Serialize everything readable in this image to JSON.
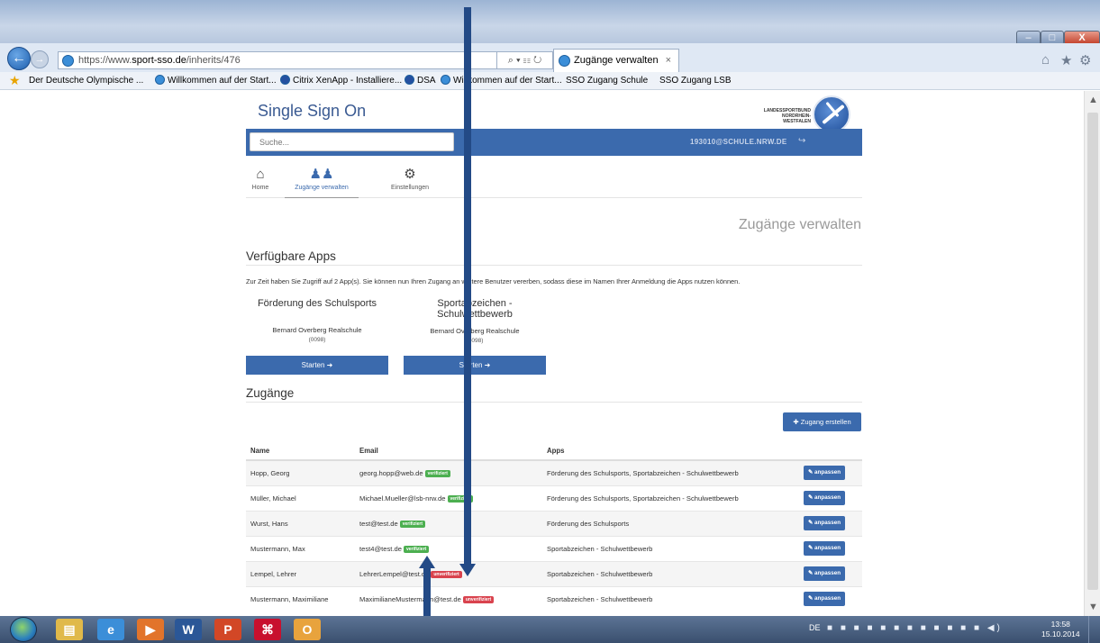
{
  "browser": {
    "url_prefix": "https://www.",
    "url_domain": "sport-sso.de",
    "url_path": "/inherits/476",
    "url_controls": "⌕ ▾ ☷ ↻",
    "tab_title": "Zugänge verwalten",
    "tab_close": "×",
    "window_buttons": {
      "minimize": "–",
      "maximize": "□",
      "close": "X"
    },
    "right_icons": [
      "⌂",
      "★",
      "⚙"
    ]
  },
  "favorites": [
    {
      "label": "Der Deutsche Olympische ...",
      "icon": "dosb-icon"
    },
    {
      "label": "Willkommen auf der Start...",
      "icon": "ie-icon"
    },
    {
      "label": "Citrix XenApp - Installiere...",
      "icon": "citrix-icon"
    },
    {
      "label": "DSA",
      "icon": "citrix-icon"
    },
    {
      "label": "Willkommen auf der Start...",
      "icon": "ie-icon"
    },
    {
      "label": "SSO Zugang Schule",
      "icon": "page-icon"
    },
    {
      "label": "SSO Zugang LSB",
      "icon": "page-icon"
    }
  ],
  "site": {
    "title": "Single Sign On",
    "logo_text_line1": "LANDESSPORTBUND",
    "logo_text_line2": "NORDRHEIN-WESTFALEN",
    "search_placeholder": "Suche...",
    "user_id": "193010@SCHULE.NRW.DE",
    "logout_icon": "↪"
  },
  "nav": [
    {
      "label": "Home",
      "icon": "⌂",
      "icon_name": "home-icon",
      "active": false
    },
    {
      "label": "Zugänge verwalten",
      "icon": "♟♟",
      "icon_name": "users-icon",
      "active": true
    },
    {
      "label": "Einstellungen",
      "icon": "⚙",
      "icon_name": "gears-icon",
      "active": false
    }
  ],
  "page_heading": "Zugänge verwalten",
  "apps_section": {
    "heading": "Verfügbare Apps",
    "intro": "Zur Zeit haben Sie Zugriff auf 2 App(s). Sie können nun Ihren Zugang an weitere Benutzer vererben, sodass diese im Namen Ihrer Anmeldung die Apps nutzen können.",
    "apps": [
      {
        "title": "Förderung des Schulsports",
        "school": "Bernard Overberg Realschule",
        "code": "(0098)",
        "button": "Starten ➜"
      },
      {
        "title": "Sportabzeichen - Schulwettbewerb",
        "school": "Bernard Overberg Realschule",
        "code": "(0098)",
        "button": "Starten ➜"
      }
    ]
  },
  "accounts_section": {
    "heading": "Zugänge",
    "create_button": "✚ Zugang erstellen",
    "columns": {
      "name": "Name",
      "email": "Email",
      "apps": "Apps"
    },
    "edit_label": "✎ anpassen",
    "rows": [
      {
        "name": "Hopp, Georg",
        "email": "georg.hopp@web.de",
        "status": "verifiziert",
        "apps": "Förderung des Schulsports, Sportabzeichen - Schulwettbewerb"
      },
      {
        "name": "Müller, Michael",
        "email": "Michael.Mueller@lsb-nrw.de",
        "status": "verifiziert",
        "apps": "Förderung des Schulsports, Sportabzeichen - Schulwettbewerb"
      },
      {
        "name": "Wurst, Hans",
        "email": "test@test.de",
        "status": "verifiziert",
        "apps": "Förderung des Schulsports"
      },
      {
        "name": "Mustermann, Max",
        "email": "test4@test.de",
        "status": "verifiziert",
        "apps": "Sportabzeichen - Schulwettbewerb"
      },
      {
        "name": "Lempel, Lehrer",
        "email": "LehrerLempel@test.de",
        "status": "unverifiziert",
        "apps": "Sportabzeichen - Schulwettbewerb"
      },
      {
        "name": "Mustermann, Maximiliane",
        "email": "MaximilianeMustermann@test.de",
        "status": "unverifiziert",
        "apps": "Sportabzeichen - Schulwettbewerb"
      }
    ]
  },
  "taskbar": {
    "apps": [
      {
        "name": "explorer",
        "glyph": "▤",
        "color": "#e0b94a"
      },
      {
        "name": "internet-explorer",
        "glyph": "e",
        "color": "#3b8ed8"
      },
      {
        "name": "media-player",
        "glyph": "▶",
        "color": "#e2742b"
      },
      {
        "name": "word",
        "glyph": "W",
        "color": "#2b5797"
      },
      {
        "name": "powerpoint",
        "glyph": "P",
        "color": "#d24726"
      },
      {
        "name": "acrobat",
        "glyph": "⌘",
        "color": "#c8102e"
      },
      {
        "name": "outlook",
        "glyph": "O",
        "color": "#e8a33d"
      }
    ],
    "language": "DE",
    "tray_icons": "■ ■ ■ ■ ■ ■ ■ ■ ■ ■ ■ ■ ◀)",
    "time": "13:58",
    "date": "15.10.2014"
  }
}
